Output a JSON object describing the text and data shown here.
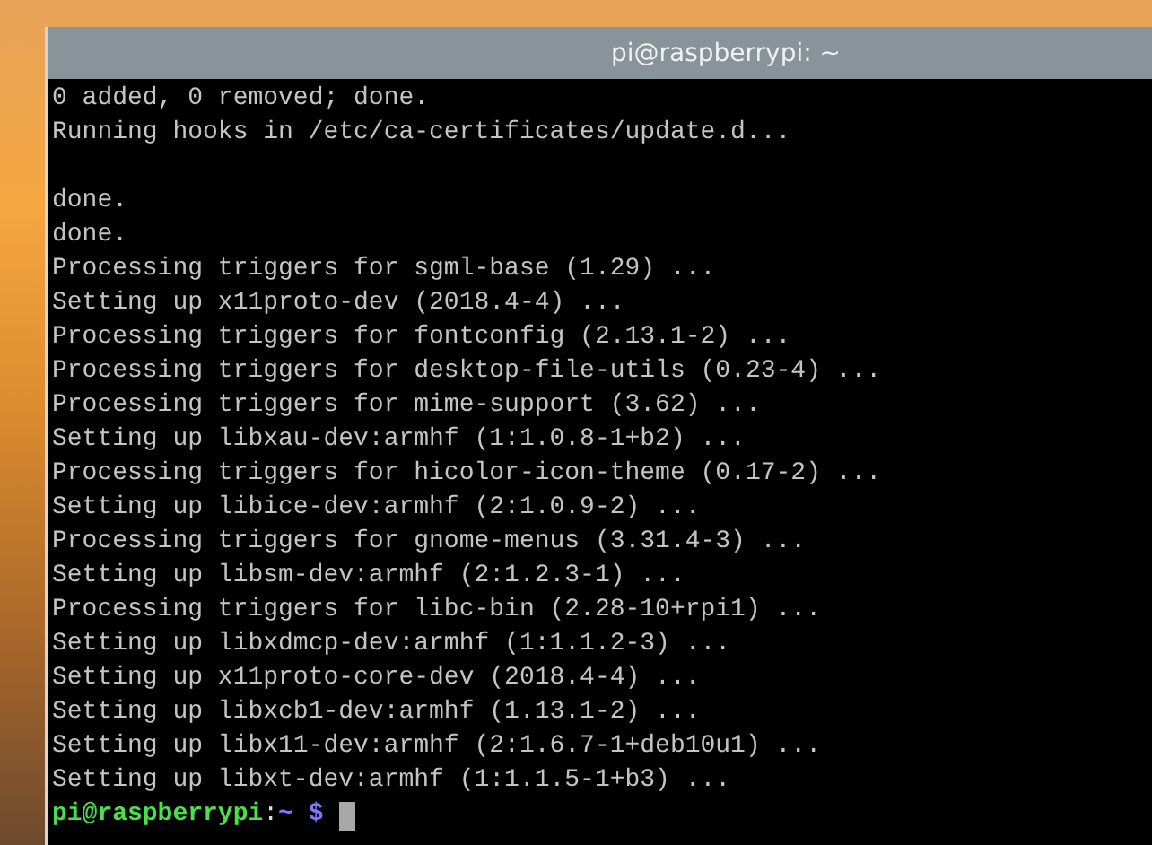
{
  "window": {
    "title": "pi@raspberrypi: ~"
  },
  "terminal": {
    "lines": [
      {
        "kind": "output",
        "text": "0 added, 0 removed; done."
      },
      {
        "kind": "output",
        "text": "Running hooks in /etc/ca-certificates/update.d..."
      },
      {
        "kind": "blank"
      },
      {
        "kind": "output",
        "text": "done."
      },
      {
        "kind": "output",
        "text": "done."
      },
      {
        "kind": "output",
        "text": "Processing triggers for sgml-base (1.29) ..."
      },
      {
        "kind": "output",
        "text": "Setting up x11proto-dev (2018.4-4) ..."
      },
      {
        "kind": "output",
        "text": "Processing triggers for fontconfig (2.13.1-2) ..."
      },
      {
        "kind": "output",
        "text": "Processing triggers for desktop-file-utils (0.23-4) ..."
      },
      {
        "kind": "output",
        "text": "Processing triggers for mime-support (3.62) ..."
      },
      {
        "kind": "output",
        "text": "Setting up libxau-dev:armhf (1:1.0.8-1+b2) ..."
      },
      {
        "kind": "output",
        "text": "Processing triggers for hicolor-icon-theme (0.17-2) ..."
      },
      {
        "kind": "output",
        "text": "Setting up libice-dev:armhf (2:1.0.9-2) ..."
      },
      {
        "kind": "output",
        "text": "Processing triggers for gnome-menus (3.31.4-3) ..."
      },
      {
        "kind": "output",
        "text": "Setting up libsm-dev:armhf (2:1.2.3-1) ..."
      },
      {
        "kind": "output",
        "text": "Processing triggers for libc-bin (2.28-10+rpi1) ..."
      },
      {
        "kind": "output",
        "text": "Setting up libxdmcp-dev:armhf (1:1.1.2-3) ..."
      },
      {
        "kind": "output",
        "text": "Setting up x11proto-core-dev (2018.4-4) ..."
      },
      {
        "kind": "output",
        "text": "Setting up libxcb1-dev:armhf (1.13.1-2) ..."
      },
      {
        "kind": "output",
        "text": "Setting up libx11-dev:armhf (2:1.6.7-1+deb10u1) ..."
      },
      {
        "kind": "output",
        "text": "Setting up libxt-dev:armhf (1:1.1.5-1+b3) ..."
      }
    ],
    "prompt": {
      "user_host": "pi@raspberrypi",
      "separator": ":",
      "path": "~",
      "symbol": "$"
    }
  }
}
